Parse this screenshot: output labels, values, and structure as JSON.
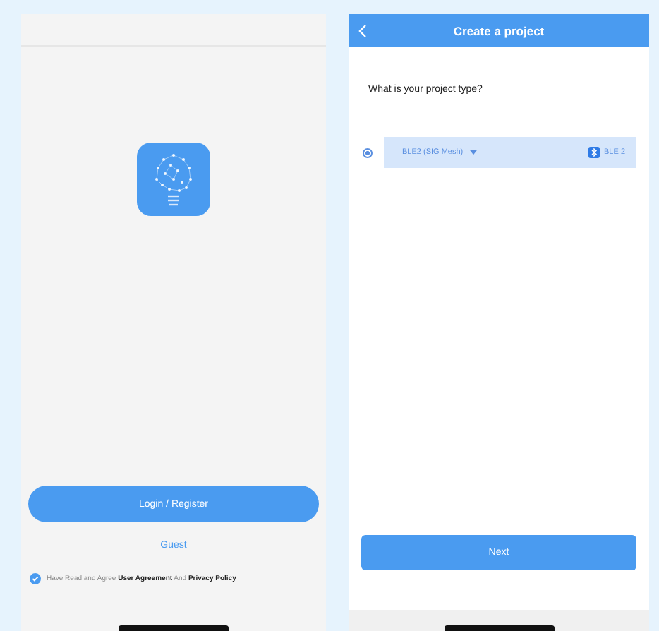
{
  "login_screen": {
    "login_button": "Login / Register",
    "guest_link": "Guest",
    "agreement": {
      "checked": true,
      "text": "Have Read and Agree **User Agreement** And **Privacy Policy**"
    }
  },
  "project_screen": {
    "title": "Create a project",
    "question": "What is your project type?",
    "options": [
      {
        "label": "BLE2 (SIG Mesh)",
        "badge": "BLE 2",
        "selected": true
      }
    ],
    "next_button": "Next"
  }
}
